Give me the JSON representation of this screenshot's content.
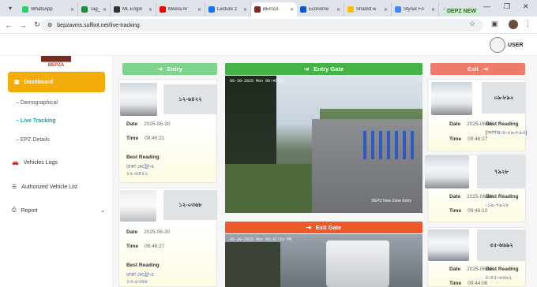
{
  "browser": {
    "tabs": [
      {
        "title": "WhatsApp",
        "color": "#25d366"
      },
      {
        "title": "Tag_table",
        "color": "#1e8e3e"
      },
      {
        "title": "ML Engin",
        "color": "#333333"
      },
      {
        "title": "Meera Ar",
        "color": "#ff0000"
      },
      {
        "title": "Lecture 2",
        "color": "#1a73e8"
      },
      {
        "title": "BEPZA",
        "color": "#7a2b1f"
      },
      {
        "title": "Econome",
        "color": "#0b57d0"
      },
      {
        "title": "Shared w",
        "color": "#fbbc04"
      },
      {
        "title": "Styrax Fo",
        "color": "#4285f4"
      }
    ],
    "url": "bepzavms.suffixit.net/live-tracking"
  },
  "header": {
    "badge": "DEPZ NEW",
    "user": "USER"
  },
  "sidebar": {
    "logo": "BEPZA",
    "dashboard": "Dashboard",
    "sub_items": [
      "Demographical",
      "Live Tracking",
      "EPZ Details"
    ],
    "items": [
      "Vehicles Logs",
      "Authorized Vehicle List",
      "Report"
    ]
  },
  "main": {
    "entry_label": "Entry",
    "exit_label": "Exit",
    "entry_gate_label": "Entry Gate",
    "exit_gate_label": "Exit Gate",
    "entry_cam_timestamp": "06-30-2025 Mon 09:46:21",
    "entry_cam_caption": "DEPZ New Zone Entry",
    "exit_cam_timestamp": "06-30-2025 Mon 09:47:53 PM",
    "field_date": "Date",
    "field_time": "Time",
    "field_best": "Best Reading",
    "entries": [
      {
        "date": "2025-06-30",
        "time": "09:46:21",
        "reading1": "ঢাকা মেট্রো-চ",
        "reading2": "১২-৬৪২২",
        "plate": "১২-৬৪২২"
      },
      {
        "date": "2025-06-30",
        "time": "09:46:27",
        "reading1": "ঢাকা মেট্রো-চ",
        "reading2": "১৩-০৩৬৮",
        "plate": "১২-০৩৬৮"
      }
    ],
    "exits": [
      {
        "date": "2025-06-30",
        "time": "09:46:27",
        "reading1": "[আশার-৪-০৯-৮৯০]",
        "plate": "০৯-৮৯০"
      },
      {
        "date": "2025-06-30",
        "time": "09:46:10",
        "reading1": "-১৯-৭৯২৮",
        "plate": "৭৯২৮"
      },
      {
        "date": "2025-06-30",
        "time": "09:44:06",
        "reading1": "চ-৫৫-৬৬৯২",
        "plate": "৫৫-৬৬৯২"
      }
    ]
  }
}
